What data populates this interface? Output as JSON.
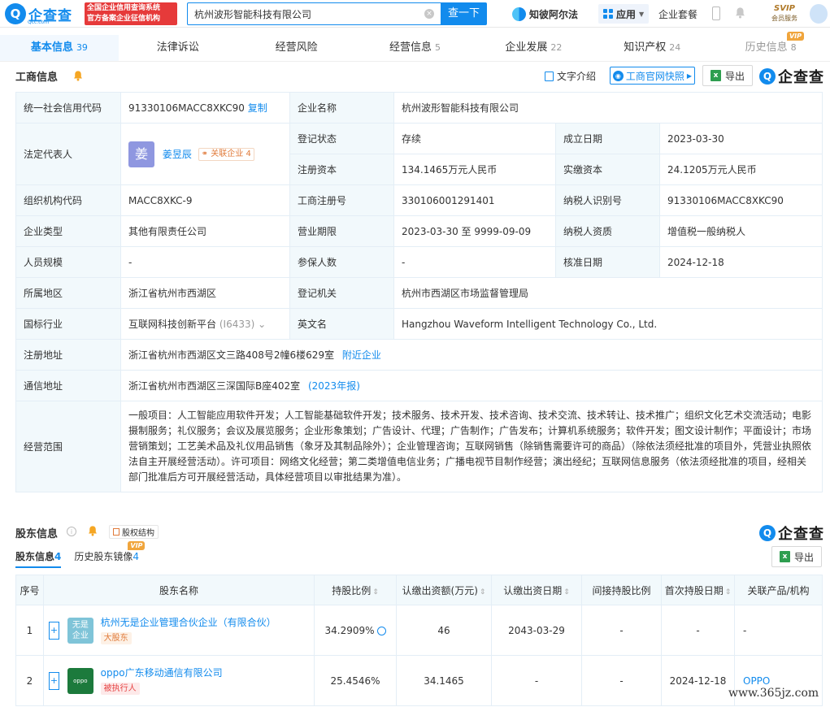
{
  "header": {
    "logo_text": "企查查",
    "logo_sub": "Qcc.com",
    "slogan_line1": "全国企业信用查询系统",
    "slogan_line2": "官方备案企业征信机构",
    "search_value": "杭州波形智能科技有限公司",
    "search_button": "查一下",
    "nav_zbr": "知彼阿尔法",
    "nav_app": "应用",
    "nav_package": "企业套餐",
    "svip": "SVIP",
    "svip_sub": "会员服务"
  },
  "tabs": [
    {
      "label": "基本信息",
      "count": "39"
    },
    {
      "label": "法律诉讼",
      "count": ""
    },
    {
      "label": "经营风险",
      "count": ""
    },
    {
      "label": "经营信息",
      "count": "5"
    },
    {
      "label": "企业发展",
      "count": "22"
    },
    {
      "label": "知识产权",
      "count": "24"
    },
    {
      "label": "历史信息",
      "count": "8",
      "badge": "VIP"
    }
  ],
  "business": {
    "title": "工商信息",
    "text_intro": "文字介绍",
    "snapshot": "工商官网快照",
    "export": "导出",
    "brand": "企查查",
    "rows": {
      "credit_code_label": "统一社会信用代码",
      "credit_code": "91330106MACC8XKC90",
      "copy": "复制",
      "company_name_label": "企业名称",
      "company_name": "杭州波形智能科技有限公司",
      "legal_rep_label": "法定代表人",
      "legal_rep_avatar": "姜",
      "legal_rep": "姜昱辰",
      "related_label": "关联企业",
      "related_count": "4",
      "reg_status_label": "登记状态",
      "reg_status": "存续",
      "found_date_label": "成立日期",
      "found_date": "2023-03-30",
      "reg_capital_label": "注册资本",
      "reg_capital": "134.1465万元人民币",
      "paid_capital_label": "实缴资本",
      "paid_capital": "24.1205万元人民币",
      "org_code_label": "组织机构代码",
      "org_code": "MACC8XKC-9",
      "reg_no_label": "工商注册号",
      "reg_no": "330106001291401",
      "taxpayer_id_label": "纳税人识别号",
      "taxpayer_id": "91330106MACC8XKC90",
      "type_label": "企业类型",
      "type": "其他有限责任公司",
      "term_label": "营业期限",
      "term": "2023-03-30 至 9999-09-09",
      "tax_qual_label": "纳税人资质",
      "tax_qual": "增值税一般纳税人",
      "staff_label": "人员规模",
      "staff": "-",
      "insured_label": "参保人数",
      "insured": "-",
      "approve_label": "核准日期",
      "approve": "2024-12-18",
      "region_label": "所属地区",
      "region": "浙江省杭州市西湖区",
      "authority_label": "登记机关",
      "authority": "杭州市西湖区市场监督管理局",
      "industry_label": "国标行业",
      "industry": "互联网科技创新平台",
      "industry_code": "(I6433)",
      "en_name_label": "英文名",
      "en_name": "Hangzhou Waveform Intelligent Technology Co., Ltd.",
      "reg_addr_label": "注册地址",
      "reg_addr": "浙江省杭州市西湖区文三路408号2幢6楼629室",
      "nearby": "附近企业",
      "mail_addr_label": "通信地址",
      "mail_addr": "浙江省杭州市西湖区三深国际B座402室",
      "annual_report": "(2023年报)",
      "scope_label": "经营范围",
      "scope": "一般项目：人工智能应用软件开发；人工智能基础软件开发；技术服务、技术开发、技术咨询、技术交流、技术转让、技术推广；组织文化艺术交流活动；电影摄制服务；礼仪服务；会议及展览服务；企业形象策划；广告设计、代理；广告制作；广告发布；计算机系统服务；软件开发；图文设计制作；平面设计；市场营销策划；工艺美术品及礼仪用品销售（象牙及其制品除外）；企业管理咨询；互联网销售（除销售需要许可的商品）（除依法须经批准的项目外，凭营业执照依法自主开展经营活动）。许可项目：网络文化经营；第二类增值电信业务；广播电视节目制作经营；演出经纪；互联网信息服务（依法须经批准的项目，经相关部门批准后方可开展经营活动，具体经营项目以审批结果为准）。"
    }
  },
  "shareholders": {
    "title": "股东信息",
    "equity_structure": "股权结构",
    "brand": "企查查",
    "export": "导出",
    "tab_current": "股东信息",
    "tab_current_count": "4",
    "tab_history": "历史股东镜像",
    "tab_history_count": "4",
    "tab_history_badge": "VIP",
    "headers": [
      "序号",
      "股东名称",
      "持股比例",
      "认缴出资额(万元)",
      "认缴出资日期",
      "间接持股比例",
      "首次持股日期",
      "关联产品/机构"
    ],
    "rows": [
      {
        "index": "1",
        "logo_line1": "无是",
        "logo_line2": "企业",
        "name": "杭州无是企业管理合伙企业（有限合伙）",
        "tag": "大股东",
        "ratio": "34.2909%",
        "capital": "46",
        "date": "2043-03-29",
        "indirect": "-",
        "first_date": "-",
        "product": "-"
      },
      {
        "index": "2",
        "logo_line1": "oppo",
        "logo_line2": "",
        "name": "oppo广东移动通信有限公司",
        "tag": "被执行人",
        "ratio": "25.4546%",
        "capital": "34.1465",
        "date": "-",
        "indirect": "-",
        "first_date": "2024-12-18",
        "product": "OPPO"
      }
    ]
  },
  "watermark": "www.365jz.com",
  "colors": {
    "accent": "#128bed",
    "label_bg": "#f2f9fc",
    "orange": "#e07a3a",
    "red": "#e64545"
  }
}
